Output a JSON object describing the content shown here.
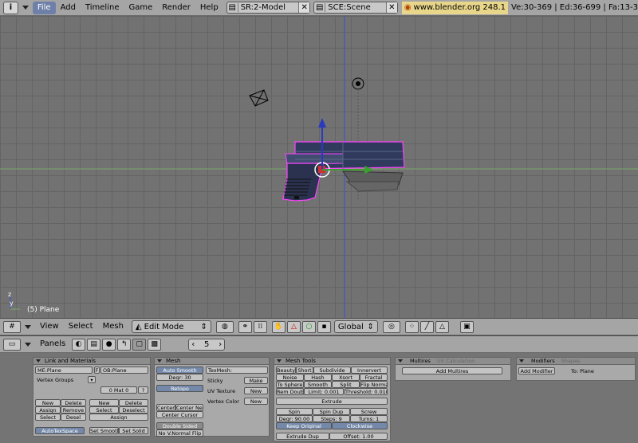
{
  "topbar": {
    "menus": [
      "File",
      "Add",
      "Timeline",
      "Game",
      "Render",
      "Help"
    ],
    "screen": "SR:2-Model",
    "scene": "SCE:Scene",
    "url": "www.blender.org 248.1",
    "stats": "Ve:30-369 | Ed:36-699 | Fa:13-3"
  },
  "viewport": {
    "object_label": "(5) Plane"
  },
  "view_header": {
    "menus": [
      "View",
      "Select",
      "Mesh"
    ],
    "mode": "Edit Mode",
    "orientation": "Global"
  },
  "buttons_header": {
    "panels_label": "Panels",
    "frame": "5"
  },
  "link_panel": {
    "title": "Link and Materials",
    "me": "ME:Plane",
    "f": "F",
    "ob": "OB:Plane",
    "vertex_groups": "Vertex Groups",
    "mat": "0 Mat 0",
    "q": "?",
    "new": "New",
    "delete": "Delete",
    "assign": "Assign",
    "remove": "Remove",
    "select": "Select",
    "desel": "Desel",
    "new2": "New",
    "delete2": "Delete",
    "select2": "Select",
    "deselect": "Deselect",
    "assign2": "Assign",
    "autotex": "AutoTexSpace",
    "set_smooth": "Set Smooth",
    "set_solid": "Set Solid"
  },
  "mesh_panel": {
    "title": "Mesh",
    "auto_smooth": "Auto Smooth",
    "degr": "Degr: 30",
    "retopo": "Retopo",
    "texmesh": "TexMesh:",
    "sticky": "Sticky",
    "make": "Make",
    "uv_texture": "UV Texture",
    "new1": "New",
    "vertex_color": "Vertex Color",
    "new2": "New",
    "center": "Center",
    "center_new": "Center New",
    "center_cursor": "Center Cursor",
    "double_sided": "Double Sided",
    "no_vnormal_flip": "No V.Normal Flip"
  },
  "mesh_tools": {
    "title": "Mesh Tools",
    "beauty": "Beauty",
    "short": "Short",
    "subdivide": "Subdivide",
    "innervert": "Innervert",
    "noise": "Noise",
    "hash": "Hash",
    "xsort": "Xsort",
    "fractal": "Fractal",
    "to_sphere": "To Sphere",
    "smooth": "Smooth",
    "split": "Split",
    "flip_normal": "Flip Normal",
    "rem_doubl": "Rem Doubl",
    "limit": "Limit: 0.001",
    "threshold": "Threshold: 0.010",
    "extrude": "Extrude",
    "spin": "Spin",
    "spin_dup": "Spin Dup",
    "screw": "Screw",
    "degr": "Degr: 90.00",
    "steps": "Steps: 9",
    "turns": "Turns: 1",
    "keep_original": "Keep Original",
    "clockwise": "Clockwise",
    "extrude_dup": "Extrude Dup",
    "offset": "Offset: 1.00"
  },
  "multires_panel": {
    "tab1": "Multires",
    "tab2": "UV Calculation",
    "add_multires": "Add Multires"
  },
  "modifiers_panel": {
    "tab1": "Modifiers",
    "tab2": "Shapes",
    "add_modifier": "Add Modifier",
    "to": "To: Plane"
  },
  "colors": {
    "viewport_bg": "#727272",
    "grid": "#646464",
    "header": "#a5a5a5",
    "x_axis": "#7aa86a",
    "z_axis": "#3b4fd1",
    "selection": "#ff44ff"
  }
}
